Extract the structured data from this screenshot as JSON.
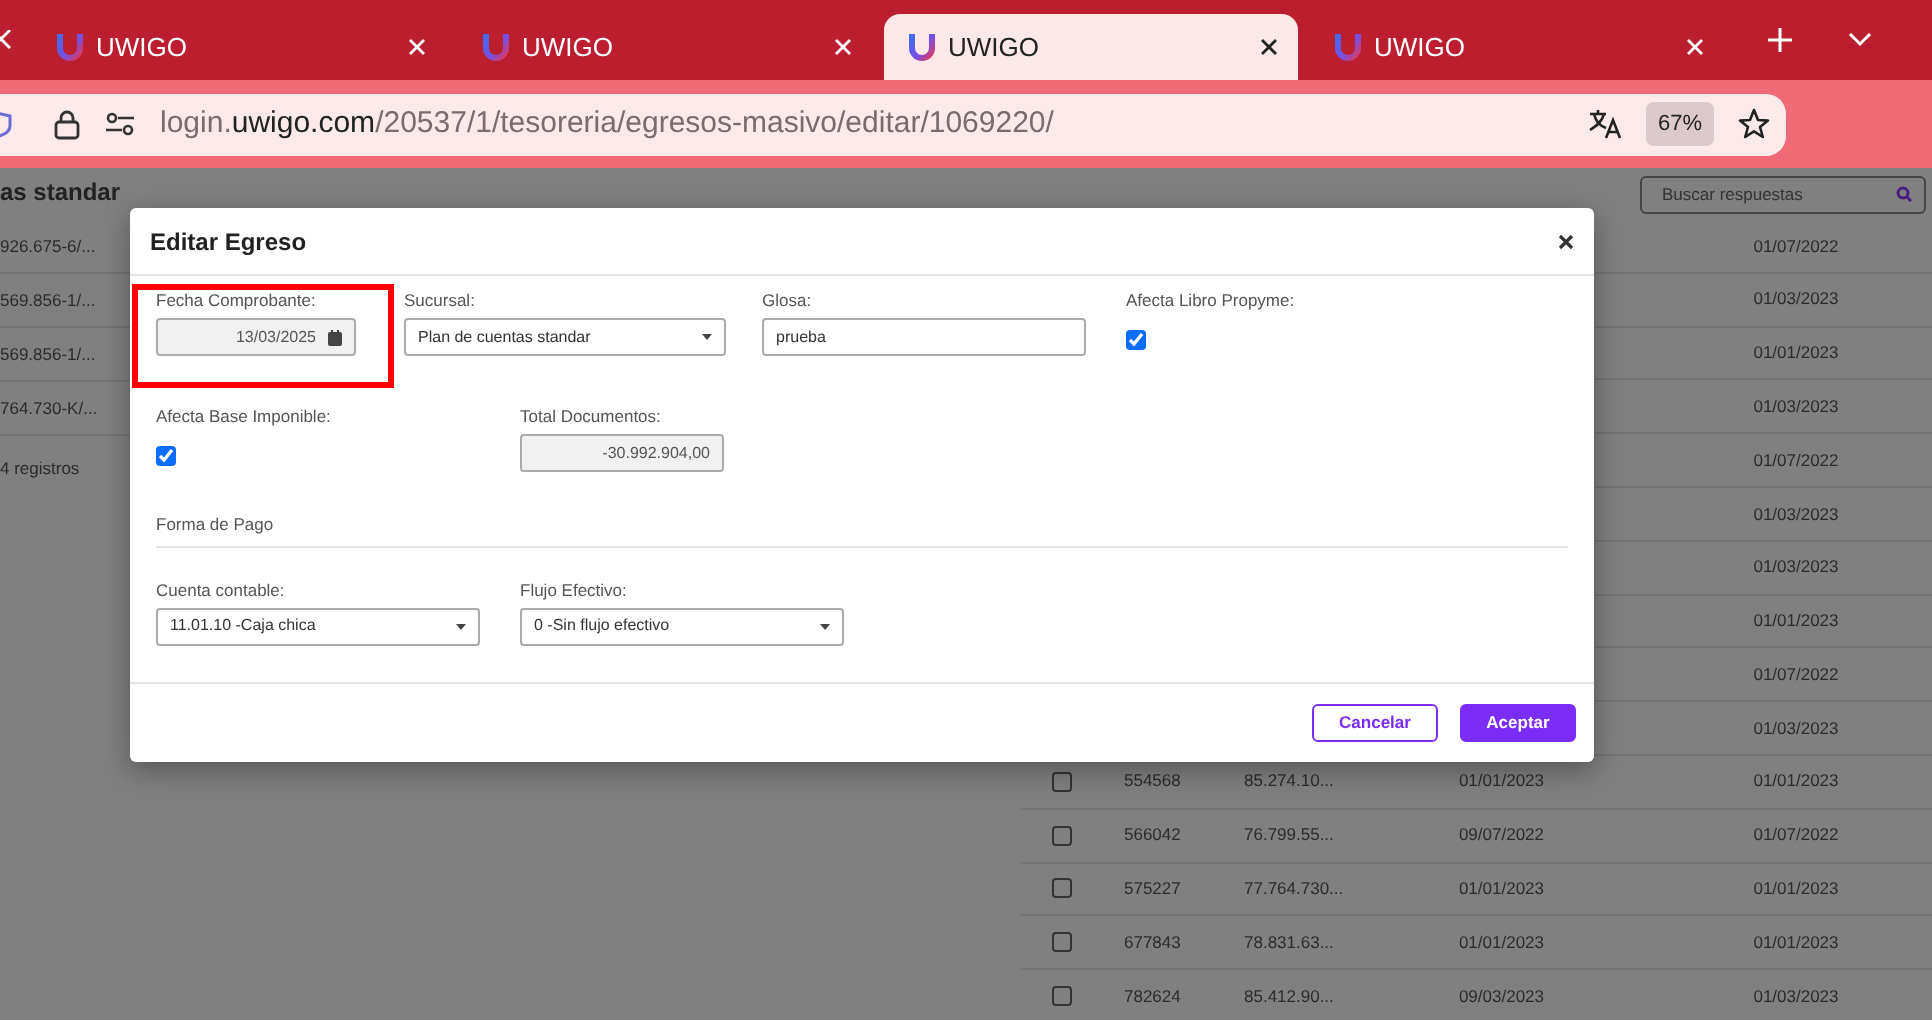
{
  "browser": {
    "tabs": [
      {
        "title": "UWIGO",
        "selected": false
      },
      {
        "title": "UWIGO",
        "selected": false
      },
      {
        "title": "UWIGO",
        "selected": true
      },
      {
        "title": "UWIGO",
        "selected": false
      }
    ],
    "address": {
      "subdomain": "login.",
      "domain": "uwigo.com",
      "path": "/20537/1/tesoreria/egresos-masivo/editar/1069220/"
    },
    "zoom": "67%"
  },
  "page": {
    "heading": "as standar",
    "left_rows": [
      "926.675-6/...",
      "569.856-1/...",
      "569.856-1/...",
      "764.730-K/..."
    ],
    "record_count": "4 registros",
    "search": {
      "placeholder": "Buscar respuestas"
    },
    "rows": [
      {
        "date_2": "01/07/2022"
      },
      {
        "date_2": "01/03/2023"
      },
      {
        "date_2": "01/01/2023"
      },
      {
        "date_2": "01/03/2023"
      },
      {
        "date_2": "01/07/2022"
      },
      {
        "date_2": "01/03/2023"
      },
      {
        "date_2": "01/03/2023"
      },
      {
        "date_2": "01/01/2023"
      },
      {
        "date_2": "01/07/2022"
      },
      {
        "date_2": "01/03/2023"
      },
      {
        "checked": false,
        "id": "554568",
        "rut": "85.274.10...",
        "date_1": "01/01/2023",
        "date_2": "01/01/2023"
      },
      {
        "checked": false,
        "id": "566042",
        "rut": "76.799.55...",
        "date_1": "09/07/2022",
        "date_2": "01/07/2022"
      },
      {
        "checked": false,
        "id": "575227",
        "rut": "77.764.730...",
        "date_1": "01/01/2023",
        "date_2": "01/01/2023"
      },
      {
        "checked": false,
        "id": "677843",
        "rut": "78.831.63...",
        "date_1": "01/01/2023",
        "date_2": "01/01/2023"
      },
      {
        "checked": false,
        "id": "782624",
        "rut": "85.412.90...",
        "date_1": "09/03/2023",
        "date_2": "01/03/2023"
      }
    ]
  },
  "modal": {
    "title": "Editar Egreso",
    "row_1": [
      {
        "kind": "date",
        "label": "Fecha Comprobante:",
        "value": "13/03/2025",
        "disabled": true,
        "highlighted": true
      },
      {
        "kind": "select",
        "label": "Sucursal:",
        "value": "Plan de cuentas standar"
      },
      {
        "kind": "text",
        "label": "Glosa:",
        "value": "prueba"
      },
      {
        "kind": "checkbox",
        "label": "Afecta Libro Propyme:",
        "checked": true
      }
    ],
    "row_2": [
      {
        "kind": "checkbox",
        "label": "Afecta Base Imponible:",
        "checked": true
      },
      {
        "kind": "text",
        "label": "Total Documentos:",
        "value": "-30.992.904,00",
        "disabled": true
      }
    ],
    "section": "Forma de Pago",
    "row_3": [
      {
        "kind": "select",
        "label": "Cuenta contable:",
        "value": "11.01.10 -Caja chica"
      },
      {
        "kind": "select",
        "label": "Flujo Efectivo:",
        "value": "0 -Sin flujo efectivo"
      }
    ],
    "buttons": [
      {
        "kind": "outline",
        "label": "Cancelar"
      },
      {
        "kind": "primary",
        "label": "Aceptar"
      }
    ]
  }
}
